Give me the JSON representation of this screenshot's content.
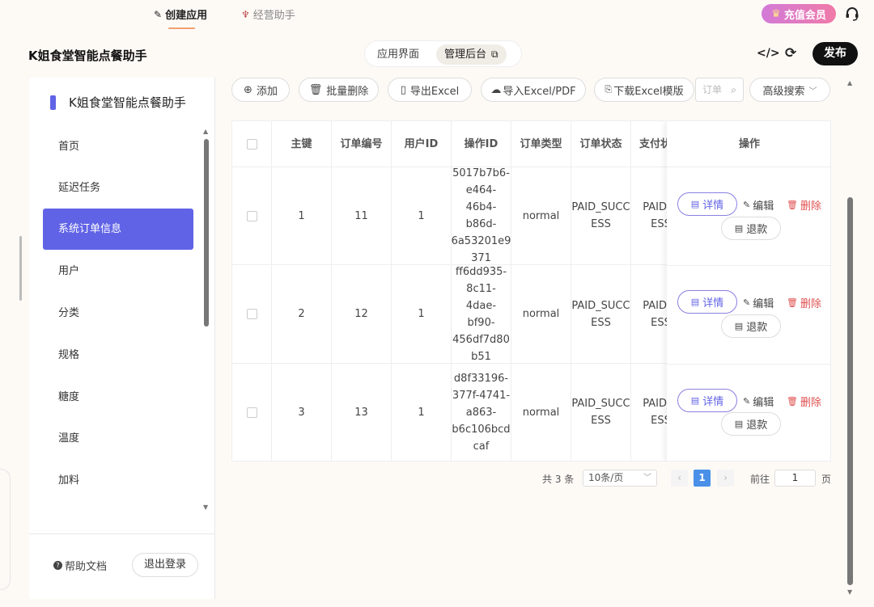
{
  "topbar": {
    "tab_create": "创建应用",
    "tab_assistant": "经营助手",
    "vip_label": "充值会员"
  },
  "header": {
    "app_title": "K姐食堂智能点餐助手",
    "view_app": "应用界面",
    "view_admin": "管理后台",
    "publish": "发布"
  },
  "sidebar": {
    "brand": "K姐食堂智能点餐助手",
    "items": [
      {
        "label": "首页"
      },
      {
        "label": "延迟任务"
      },
      {
        "label": "系统订单信息"
      },
      {
        "label": "用户"
      },
      {
        "label": "分类"
      },
      {
        "label": "规格"
      },
      {
        "label": "糖度"
      },
      {
        "label": "温度"
      },
      {
        "label": "加料"
      }
    ],
    "active_index": 2,
    "help": "帮助文档",
    "logout": "退出登录"
  },
  "toolbar": {
    "add": "添加",
    "batch_delete": "批量删除",
    "export_excel": "导出Excel",
    "import": "导入Excel/PDF",
    "download_template": "下载Excel模版",
    "search_placeholder": "订单",
    "advanced_search": "高级搜索"
  },
  "table": {
    "headers": [
      "主键",
      "订单编号",
      "用户ID",
      "操作ID",
      "订单类型",
      "订单状态",
      "支付状",
      "操作"
    ],
    "rows": [
      {
        "id": "1",
        "order_no": "11",
        "user_id": "1",
        "op_id": [
          "5017b7b6-",
          "e464-46b4-",
          "b86d-",
          "6a53201e9",
          "371"
        ],
        "type": "normal",
        "status": [
          "PAID_SUCC",
          "ESS"
        ],
        "pay": [
          "PAID_S",
          "ESS"
        ]
      },
      {
        "id": "2",
        "order_no": "12",
        "user_id": "1",
        "op_id": [
          "ff6dd935-",
          "8c11-4dae-",
          "bf90-",
          "456df7d80",
          "b51"
        ],
        "type": "normal",
        "status": [
          "PAID_SUCC",
          "ESS"
        ],
        "pay": [
          "PAID_S",
          "ESS"
        ]
      },
      {
        "id": "3",
        "order_no": "13",
        "user_id": "1",
        "op_id": [
          "d8f33196-",
          "377f-4741-",
          "a863-",
          "b6c106bcd",
          "caf"
        ],
        "type": "normal",
        "status": [
          "PAID_SUCC",
          "ESS"
        ],
        "pay": [
          "PAID_S",
          "ESS"
        ]
      }
    ],
    "actions": {
      "detail": "详情",
      "edit": "编辑",
      "delete": "删除",
      "refund": "退款"
    }
  },
  "pagination": {
    "total": "共 3 条",
    "page_size": "10条/页",
    "current_page": "1",
    "goto_label": "前往",
    "goto_value": "1",
    "page_suffix": "页"
  },
  "colors": {
    "accent": "#6163e6",
    "danger": "#e05050",
    "page_active": "#4a90e8"
  }
}
